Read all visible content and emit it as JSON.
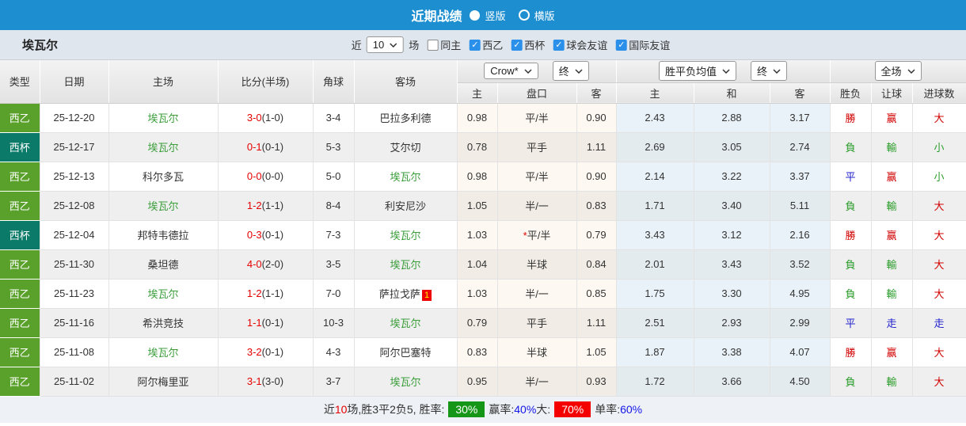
{
  "titlebar": {
    "title": "近期战绩",
    "radio_vertical_label": "竖版",
    "radio_horizontal_label": "横版"
  },
  "filterbar": {
    "team": "埃瓦尔",
    "recent_label": "近",
    "recent_value": "10",
    "matches_label": "场",
    "checkboxes": [
      {
        "label": "同主",
        "checked": "false"
      },
      {
        "label": "西乙",
        "checked": "true"
      },
      {
        "label": "西杯",
        "checked": "true"
      },
      {
        "label": "球会友谊",
        "checked": "true"
      },
      {
        "label": "国际友谊",
        "checked": "true"
      }
    ]
  },
  "table": {
    "controls": {
      "odds_company": "Crow*",
      "odds_stage": "终",
      "mean_type": "胜平负均值",
      "mean_stage": "终",
      "scope": "全场"
    },
    "columns": [
      "类型",
      "日期",
      "主场",
      "比分(半场)",
      "角球",
      "客场",
      "主",
      "盘口",
      "客",
      "主",
      "和",
      "客",
      "胜负",
      "让球",
      "进球数"
    ],
    "type_colors": {
      "西乙": "#5aa12b",
      "西杯": "#0b7a68"
    },
    "rows": [
      {
        "type": "西乙",
        "date": "25-12-20",
        "home": "埃瓦尔",
        "home_hl": "1",
        "score_ft": "3-0",
        "score_ht": "(1-0)",
        "corners": "3-4",
        "away": "巴拉多利德",
        "away_hl": "0",
        "away_badge": "",
        "odds_home": "0.98",
        "handicap_star": "",
        "handicap": "平/半",
        "odds_away": "0.90",
        "mean_home": "2.43",
        "mean_draw": "2.88",
        "mean_away": "3.17",
        "result": "勝",
        "result_c": "red",
        "spread": "赢",
        "spread_c": "red",
        "goals": "大",
        "goals_c": "red"
      },
      {
        "type": "西杯",
        "date": "25-12-17",
        "home": "埃瓦尔",
        "home_hl": "1",
        "score_ft": "0-1",
        "score_ht": "(0-1)",
        "corners": "5-3",
        "away": "艾尔切",
        "away_hl": "0",
        "away_badge": "",
        "odds_home": "0.78",
        "handicap_star": "",
        "handicap": "平手",
        "odds_away": "1.11",
        "mean_home": "2.69",
        "mean_draw": "3.05",
        "mean_away": "2.74",
        "result": "負",
        "result_c": "green",
        "spread": "輸",
        "spread_c": "green",
        "goals": "小",
        "goals_c": "green"
      },
      {
        "type": "西乙",
        "date": "25-12-13",
        "home": "科尔多瓦",
        "home_hl": "0",
        "score_ft": "0-0",
        "score_ht": "(0-0)",
        "corners": "5-0",
        "away": "埃瓦尔",
        "away_hl": "1",
        "away_badge": "",
        "odds_home": "0.98",
        "handicap_star": "",
        "handicap": "平/半",
        "odds_away": "0.90",
        "mean_home": "2.14",
        "mean_draw": "3.22",
        "mean_away": "3.37",
        "result": "平",
        "result_c": "blue",
        "spread": "赢",
        "spread_c": "red",
        "goals": "小",
        "goals_c": "green"
      },
      {
        "type": "西乙",
        "date": "25-12-08",
        "home": "埃瓦尔",
        "home_hl": "1",
        "score_ft": "1-2",
        "score_ht": "(1-1)",
        "corners": "8-4",
        "away": "利安尼沙",
        "away_hl": "0",
        "away_badge": "",
        "odds_home": "1.05",
        "handicap_star": "",
        "handicap": "半/一",
        "odds_away": "0.83",
        "mean_home": "1.71",
        "mean_draw": "3.40",
        "mean_away": "5.11",
        "result": "負",
        "result_c": "green",
        "spread": "輸",
        "spread_c": "green",
        "goals": "大",
        "goals_c": "red"
      },
      {
        "type": "西杯",
        "date": "25-12-04",
        "home": "邦特韦德拉",
        "home_hl": "0",
        "score_ft": "0-3",
        "score_ht": "(0-1)",
        "corners": "7-3",
        "away": "埃瓦尔",
        "away_hl": "1",
        "away_badge": "",
        "odds_home": "1.03",
        "handicap_star": "*",
        "handicap": "平/半",
        "odds_away": "0.79",
        "mean_home": "3.43",
        "mean_draw": "3.12",
        "mean_away": "2.16",
        "result": "勝",
        "result_c": "red",
        "spread": "赢",
        "spread_c": "red",
        "goals": "大",
        "goals_c": "red"
      },
      {
        "type": "西乙",
        "date": "25-11-30",
        "home": "桑坦德",
        "home_hl": "0",
        "score_ft": "4-0",
        "score_ht": "(2-0)",
        "corners": "3-5",
        "away": "埃瓦尔",
        "away_hl": "1",
        "away_badge": "",
        "odds_home": "1.04",
        "handicap_star": "",
        "handicap": "半球",
        "odds_away": "0.84",
        "mean_home": "2.01",
        "mean_draw": "3.43",
        "mean_away": "3.52",
        "result": "負",
        "result_c": "green",
        "spread": "輸",
        "spread_c": "green",
        "goals": "大",
        "goals_c": "red"
      },
      {
        "type": "西乙",
        "date": "25-11-23",
        "home": "埃瓦尔",
        "home_hl": "1",
        "score_ft": "1-2",
        "score_ht": "(1-1)",
        "corners": "7-0",
        "away": "萨拉戈萨",
        "away_hl": "0",
        "away_badge": "1",
        "odds_home": "1.03",
        "handicap_star": "",
        "handicap": "半/一",
        "odds_away": "0.85",
        "mean_home": "1.75",
        "mean_draw": "3.30",
        "mean_away": "4.95",
        "result": "負",
        "result_c": "green",
        "spread": "輸",
        "spread_c": "green",
        "goals": "大",
        "goals_c": "red"
      },
      {
        "type": "西乙",
        "date": "25-11-16",
        "home": "希洪竞技",
        "home_hl": "0",
        "score_ft": "1-1",
        "score_ht": "(0-1)",
        "corners": "10-3",
        "away": "埃瓦尔",
        "away_hl": "1",
        "away_badge": "",
        "odds_home": "0.79",
        "handicap_star": "",
        "handicap": "平手",
        "odds_away": "1.11",
        "mean_home": "2.51",
        "mean_draw": "2.93",
        "mean_away": "2.99",
        "result": "平",
        "result_c": "blue",
        "spread": "走",
        "spread_c": "blue",
        "goals": "走",
        "goals_c": "blue"
      },
      {
        "type": "西乙",
        "date": "25-11-08",
        "home": "埃瓦尔",
        "home_hl": "1",
        "score_ft": "3-2",
        "score_ht": "(0-1)",
        "corners": "4-3",
        "away": "阿尔巴塞特",
        "away_hl": "0",
        "away_badge": "",
        "odds_home": "0.83",
        "handicap_star": "",
        "handicap": "半球",
        "odds_away": "1.05",
        "mean_home": "1.87",
        "mean_draw": "3.38",
        "mean_away": "4.07",
        "result": "勝",
        "result_c": "red",
        "spread": "赢",
        "spread_c": "red",
        "goals": "大",
        "goals_c": "red"
      },
      {
        "type": "西乙",
        "date": "25-11-02",
        "home": "阿尔梅里亚",
        "home_hl": "0",
        "score_ft": "3-1",
        "score_ht": "(3-0)",
        "corners": "3-7",
        "away": "埃瓦尔",
        "away_hl": "1",
        "away_badge": "",
        "odds_home": "0.95",
        "handicap_star": "",
        "handicap": "半/一",
        "odds_away": "0.93",
        "mean_home": "1.72",
        "mean_draw": "3.66",
        "mean_away": "4.50",
        "result": "負",
        "result_c": "green",
        "spread": "輸",
        "spread_c": "green",
        "goals": "大",
        "goals_c": "red"
      }
    ]
  },
  "summary": {
    "recent_label": "近",
    "recent_count": "10",
    "stats_text": "场,胜3平2负5, 胜率:",
    "win_rate_badge": "30%",
    "handicap_label": "赢率:",
    "handicap_value": "40%",
    "big_label": "大:",
    "big_badge": "70%",
    "single_label": "单率:",
    "single_value": "60%"
  }
}
